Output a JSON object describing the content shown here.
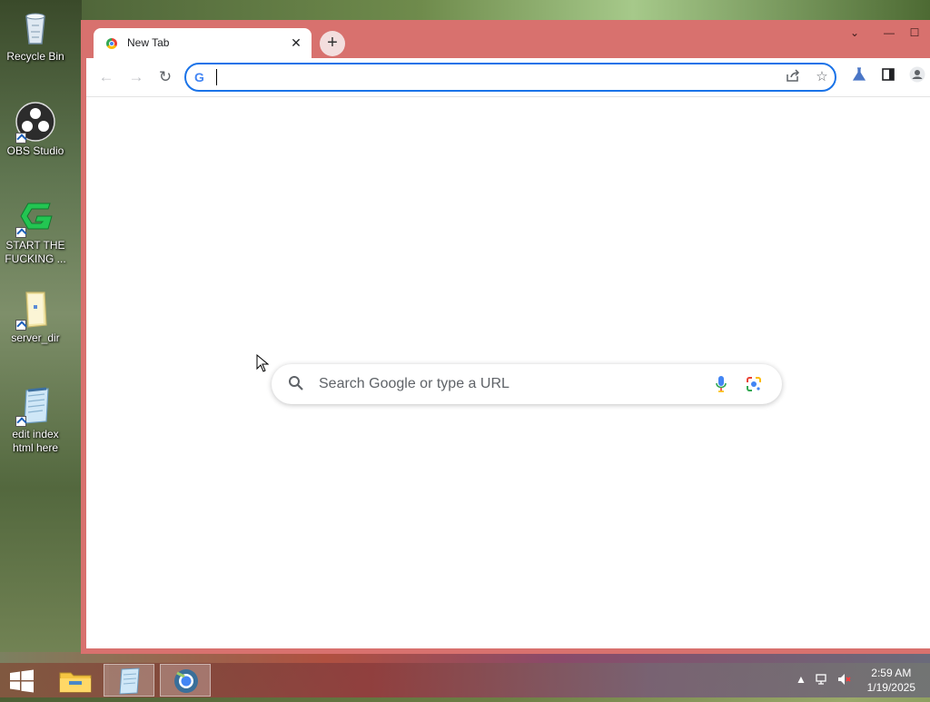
{
  "desktop": {
    "icons": [
      {
        "label": "Recycle Bin"
      },
      {
        "label": "OBS Studio"
      },
      {
        "label": "START THE FUCKING ..."
      },
      {
        "label": "server_dir"
      },
      {
        "label": "edit index html here"
      }
    ]
  },
  "browser": {
    "tab": {
      "title": "New Tab",
      "close_icon": "close-icon"
    },
    "new_tab_icon": "plus-icon",
    "window_controls": {
      "dropdown": "⌄",
      "minimize": "—",
      "maximize": "☐"
    },
    "toolbar": {
      "back_icon": "←",
      "forward_icon": "→",
      "reload_icon": "↻",
      "omnibox": {
        "value": "",
        "google_letter": "G"
      },
      "share_icon": "share-icon",
      "star_icon": "☆",
      "labs_icon": "labs-icon",
      "sidepanel_icon": "side-panel-icon",
      "profile_icon": "profile-icon"
    },
    "ntp": {
      "search_placeholder": "Search Google or type a URL"
    }
  },
  "taskbar": {
    "apps": [
      "file-explorer",
      "notepad",
      "chrome"
    ],
    "clock": {
      "time": "2:59 AM",
      "date": "1/19/2025"
    }
  },
  "colors": {
    "window_frame": "#d8716e",
    "accent": "#1a73e8"
  }
}
